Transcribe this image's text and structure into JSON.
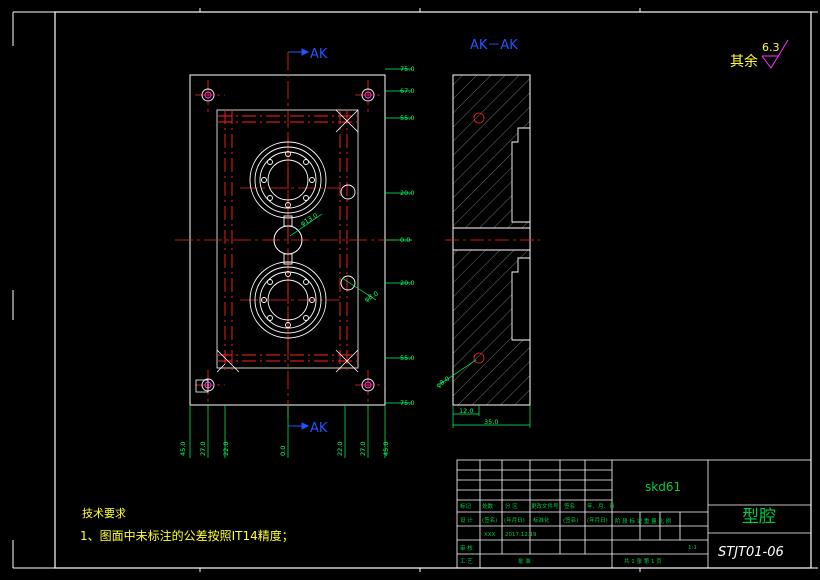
{
  "section_marks": {
    "top": "AK",
    "bottom": "AK",
    "section_title": "AK－AK"
  },
  "roughness": {
    "prefix": "其余",
    "value": "6.3"
  },
  "dims_right": [
    "75.0",
    "67.0",
    "55.0",
    "20.0",
    "0.0",
    "20.0",
    "55.0",
    "75.0"
  ],
  "dims_bottom": [
    "45.0",
    "27.0",
    "22.0",
    "0.0",
    "22.0",
    "27.0",
    "45.0"
  ],
  "dim_gate": "φ13.0",
  "dim_hole": "φ8.0",
  "dim_section_hole": "φ8.0",
  "dim_section_small": "12.0",
  "dim_section_width": "35.0",
  "tech": {
    "heading": "技术要求",
    "line1": "1、图面中未标注的公差按照IT14精度；"
  },
  "title_block": {
    "material": "skd61",
    "part_name": "型腔",
    "drawing_no": "STJT01-06",
    "scale": "1:1",
    "labels_row1": [
      "标记",
      "处数",
      "分  区",
      "更改文件号",
      "签名",
      "年、月、日"
    ],
    "labels_row2": [
      "设  计",
      "(签名)",
      "(年月日)",
      "标准化",
      "(签名)",
      "(年月日)"
    ],
    "designer": "XXX",
    "date": "2017.12.19",
    "stage_labels": "阶  段  标  记   重  量   比  例",
    "review": "审  核",
    "process": "工  艺",
    "approve": "批  准",
    "sheets": "共  1  张     第  1  页"
  },
  "colors": {
    "frame": "#ffffff",
    "part": "#ffffff",
    "center": "#ff0000",
    "dim": "#00ff66",
    "section_mark": "#2255ff",
    "title_text": "#00cc44",
    "roughness": "#ffff33",
    "roughness_sym": "#ff33ff"
  }
}
